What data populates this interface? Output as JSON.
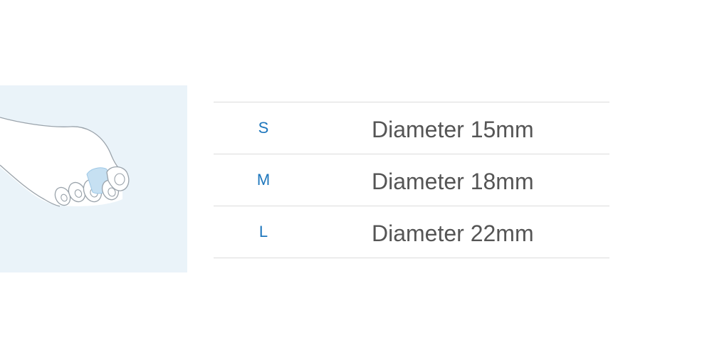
{
  "sizes": [
    {
      "size": "S",
      "description": "Diameter 15mm"
    },
    {
      "size": "M",
      "description": "Diameter 18mm"
    },
    {
      "size": "L",
      "description": "Diameter 22mm"
    }
  ],
  "colors": {
    "panel_bg": "#eaf3f9",
    "size_text": "#1e77bd",
    "desc_text": "#555555",
    "divider": "#dcdcdc",
    "sleeve": "#c6e0f2",
    "outline": "#9aa3ab"
  },
  "icons": {
    "illustration": "foot-with-toe-sleeve-icon"
  }
}
